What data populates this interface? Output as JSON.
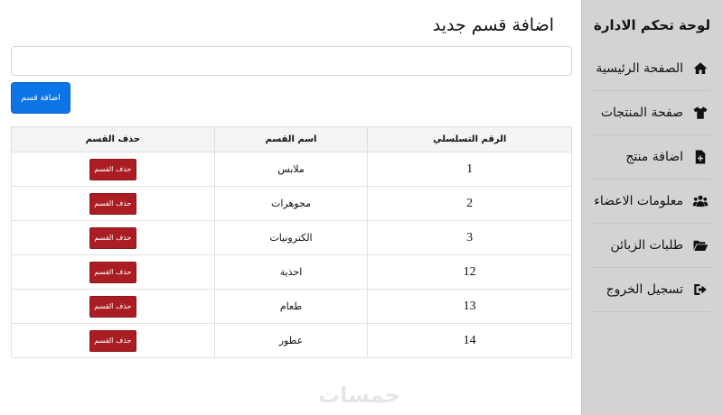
{
  "sidebar": {
    "title": "لوحة تحكم الادارة",
    "items": [
      {
        "label": "الصفحة الرئيسية",
        "icon": "home-icon"
      },
      {
        "label": "صفحة المنتجات",
        "icon": "shirt-icon"
      },
      {
        "label": "اضافة منتج",
        "icon": "file-plus-icon"
      },
      {
        "label": "معلومات الاعضاء",
        "icon": "users-icon"
      },
      {
        "label": "طلبات الزبائن",
        "icon": "folder-open-icon"
      },
      {
        "label": "تسجيل الخروج",
        "icon": "sign-out-icon"
      }
    ]
  },
  "main": {
    "title": "اضافة قسم جديد",
    "input_value": "",
    "add_button": "اضافة قسم"
  },
  "table": {
    "headers": {
      "number": "الرقم التسلسلي",
      "name": "اسم القسم",
      "delete": "حذف القسم"
    },
    "rows": [
      {
        "number": "1",
        "name": "ملابس",
        "delete": "حذف القسم"
      },
      {
        "number": "2",
        "name": "مجوهرات",
        "delete": "حذف القسم"
      },
      {
        "number": "3",
        "name": "الكترونيات",
        "delete": "حذف القسم"
      },
      {
        "number": "12",
        "name": "احذية",
        "delete": "حذف القسم"
      },
      {
        "number": "13",
        "name": "طعام",
        "delete": "حذف القسم"
      },
      {
        "number": "14",
        "name": "عطور",
        "delete": "حذف القسم"
      }
    ]
  },
  "watermark": "خمسات",
  "colors": {
    "primary": "#0d74e7",
    "danger": "#a91d23",
    "sidebar": "#d3d3d3"
  }
}
